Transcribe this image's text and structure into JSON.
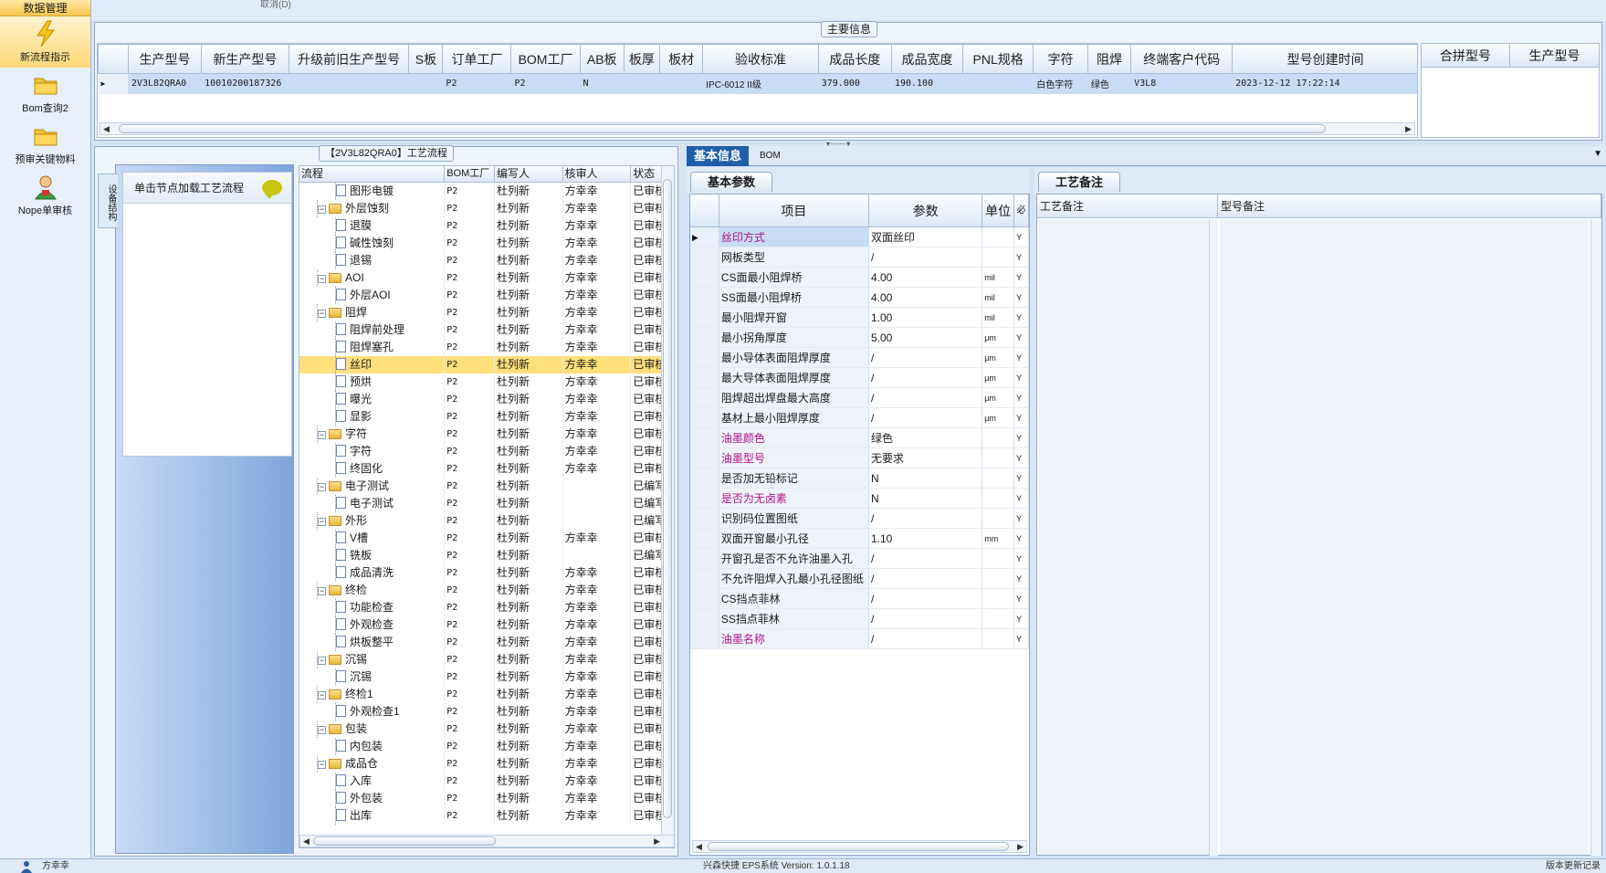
{
  "nav": {
    "header": "数据管理",
    "items": [
      {
        "label": "新流程指示",
        "icon": "lightning-icon"
      },
      {
        "label": "Bom查询2",
        "icon": "folder-icon"
      },
      {
        "label": "预审关键物料",
        "icon": "folder-icon"
      },
      {
        "label": "Nope单审核",
        "icon": "user-icon"
      }
    ]
  },
  "top_strip_text": "取消(D)",
  "main_info": {
    "legend": "主要信息",
    "columns": [
      "生产型号",
      "新生产型号",
      "升级前旧生产型号",
      "S板",
      "订单工厂",
      "BOM工厂",
      "AB板",
      "板厚",
      "板材",
      "验收标准",
      "成品长度",
      "成品宽度",
      "PNL规格",
      "字符",
      "阻焊",
      "终端客户代码",
      "型号创建时间"
    ],
    "row": [
      "2V3L82QRA0",
      "10010200187326",
      "",
      "",
      "P2",
      "P2",
      "N",
      "",
      "",
      "IPC-6012 II级",
      "379.000",
      "190.100",
      "",
      "白色字符",
      "绿色",
      "V3L8",
      "2023-12-12 17:22:14"
    ],
    "side_columns": [
      "合拼型号",
      "生产型号"
    ]
  },
  "process": {
    "legend": "【2V3L82QRA0】工艺流程",
    "side_tab": "设备结构",
    "hint": "单击节点加载工艺流程",
    "columns": [
      "流程",
      "BOM工厂",
      "编写人",
      "核审人",
      "状态"
    ],
    "rows": [
      {
        "name": "图形电镀",
        "level": 2,
        "folder": false,
        "bom": "P2",
        "editor": "杜列新",
        "reviewer": "方幸幸",
        "status": "已审核"
      },
      {
        "name": "外层蚀刻",
        "level": 1,
        "folder": true,
        "bom": "P2",
        "editor": "杜列新",
        "reviewer": "方幸幸",
        "status": "已审核"
      },
      {
        "name": "退膜",
        "level": 2,
        "folder": false,
        "bom": "P2",
        "editor": "杜列新",
        "reviewer": "方幸幸",
        "status": "已审核"
      },
      {
        "name": "碱性蚀刻",
        "level": 2,
        "folder": false,
        "bom": "P2",
        "editor": "杜列新",
        "reviewer": "方幸幸",
        "status": "已审核"
      },
      {
        "name": "退锡",
        "level": 2,
        "folder": false,
        "bom": "P2",
        "editor": "杜列新",
        "reviewer": "方幸幸",
        "status": "已审核"
      },
      {
        "name": "AOI",
        "level": 1,
        "folder": true,
        "bom": "P2",
        "editor": "杜列新",
        "reviewer": "方幸幸",
        "status": "已审核"
      },
      {
        "name": "外层AOI",
        "level": 2,
        "folder": false,
        "bom": "P2",
        "editor": "杜列新",
        "reviewer": "方幸幸",
        "status": "已审核"
      },
      {
        "name": "阻焊",
        "level": 1,
        "folder": true,
        "bom": "P2",
        "editor": "杜列新",
        "reviewer": "方幸幸",
        "status": "已审核"
      },
      {
        "name": "阻焊前处理",
        "level": 2,
        "folder": false,
        "bom": "P2",
        "editor": "杜列新",
        "reviewer": "方幸幸",
        "status": "已审核"
      },
      {
        "name": "阻焊塞孔",
        "level": 2,
        "folder": false,
        "bom": "P2",
        "editor": "杜列新",
        "reviewer": "方幸幸",
        "status": "已审核"
      },
      {
        "name": "丝印",
        "level": 2,
        "folder": false,
        "bom": "P2",
        "editor": "杜列新",
        "reviewer": "方幸幸",
        "status": "已审核",
        "selected": true
      },
      {
        "name": "预烘",
        "level": 2,
        "folder": false,
        "bom": "P2",
        "editor": "杜列新",
        "reviewer": "方幸幸",
        "status": "已审核"
      },
      {
        "name": "曝光",
        "level": 2,
        "folder": false,
        "bom": "P2",
        "editor": "杜列新",
        "reviewer": "方幸幸",
        "status": "已审核"
      },
      {
        "name": "显影",
        "level": 2,
        "folder": false,
        "bom": "P2",
        "editor": "杜列新",
        "reviewer": "方幸幸",
        "status": "已审核"
      },
      {
        "name": "字符",
        "level": 1,
        "folder": true,
        "bom": "P2",
        "editor": "杜列新",
        "reviewer": "方幸幸",
        "status": "已审核"
      },
      {
        "name": "字符",
        "level": 2,
        "folder": false,
        "bom": "P2",
        "editor": "杜列新",
        "reviewer": "方幸幸",
        "status": "已审核"
      },
      {
        "name": "终固化",
        "level": 2,
        "folder": false,
        "bom": "P2",
        "editor": "杜列新",
        "reviewer": "方幸幸",
        "status": "已审核"
      },
      {
        "name": "电子测试",
        "level": 1,
        "folder": true,
        "bom": "P2",
        "editor": "杜列新",
        "reviewer": "",
        "status": "已编写"
      },
      {
        "name": "电子测试",
        "level": 2,
        "folder": false,
        "bom": "P2",
        "editor": "杜列新",
        "reviewer": "",
        "status": "已编写"
      },
      {
        "name": "外形",
        "level": 1,
        "folder": true,
        "bom": "P2",
        "editor": "杜列新",
        "reviewer": "",
        "status": "已编写"
      },
      {
        "name": "V槽",
        "level": 2,
        "folder": false,
        "bom": "P2",
        "editor": "杜列新",
        "reviewer": "方幸幸",
        "status": "已审核"
      },
      {
        "name": "铣板",
        "level": 2,
        "folder": false,
        "bom": "P2",
        "editor": "杜列新",
        "reviewer": "",
        "status": "已编写"
      },
      {
        "name": "成品清洗",
        "level": 2,
        "folder": false,
        "bom": "P2",
        "editor": "杜列新",
        "reviewer": "方幸幸",
        "status": "已审核"
      },
      {
        "name": "终检",
        "level": 1,
        "folder": true,
        "bom": "P2",
        "editor": "杜列新",
        "reviewer": "方幸幸",
        "status": "已审核"
      },
      {
        "name": "功能检查",
        "level": 2,
        "folder": false,
        "bom": "P2",
        "editor": "杜列新",
        "reviewer": "方幸幸",
        "status": "已审核"
      },
      {
        "name": "外观检查",
        "level": 2,
        "folder": false,
        "bom": "P2",
        "editor": "杜列新",
        "reviewer": "方幸幸",
        "status": "已审核"
      },
      {
        "name": "烘板整平",
        "level": 2,
        "folder": false,
        "bom": "P2",
        "editor": "杜列新",
        "reviewer": "方幸幸",
        "status": "已审核"
      },
      {
        "name": "沉锡",
        "level": 1,
        "folder": true,
        "bom": "P2",
        "editor": "杜列新",
        "reviewer": "方幸幸",
        "status": "已审核"
      },
      {
        "name": "沉锡",
        "level": 2,
        "folder": false,
        "bom": "P2",
        "editor": "杜列新",
        "reviewer": "方幸幸",
        "status": "已审核"
      },
      {
        "name": "终检1",
        "level": 1,
        "folder": true,
        "bom": "P2",
        "editor": "杜列新",
        "reviewer": "方幸幸",
        "status": "已审核"
      },
      {
        "name": "外观检查1",
        "level": 2,
        "folder": false,
        "bom": "P2",
        "editor": "杜列新",
        "reviewer": "方幸幸",
        "status": "已审核"
      },
      {
        "name": "包装",
        "level": 1,
        "folder": true,
        "bom": "P2",
        "editor": "杜列新",
        "reviewer": "方幸幸",
        "status": "已审核"
      },
      {
        "name": "内包装",
        "level": 2,
        "folder": false,
        "bom": "P2",
        "editor": "杜列新",
        "reviewer": "方幸幸",
        "status": "已审核"
      },
      {
        "name": "成品仓",
        "level": 1,
        "folder": true,
        "bom": "P2",
        "editor": "杜列新",
        "reviewer": "方幸幸",
        "status": "已审核"
      },
      {
        "name": "入库",
        "level": 2,
        "folder": false,
        "bom": "P2",
        "editor": "杜列新",
        "reviewer": "方幸幸",
        "status": "已审核"
      },
      {
        "name": "外包装",
        "level": 2,
        "folder": false,
        "bom": "P2",
        "editor": "杜列新",
        "reviewer": "方幸幸",
        "status": "已审核"
      },
      {
        "name": "出库",
        "level": 2,
        "folder": false,
        "bom": "P2",
        "editor": "杜列新",
        "reviewer": "方幸幸",
        "status": "已审核"
      }
    ]
  },
  "right": {
    "tabs": [
      "基本信息",
      "BOM"
    ],
    "subtab_params": "基本参数",
    "subtab_remarks": "工艺备注",
    "param_columns": [
      "项目",
      "参数",
      "单位",
      "必"
    ],
    "params": [
      {
        "item": "丝印方式",
        "value": "双面丝印",
        "unit": "",
        "flag": "Y",
        "highlight": true,
        "selected": true
      },
      {
        "item": "网板类型",
        "value": "/",
        "unit": "",
        "flag": "Y"
      },
      {
        "item": "CS面最小阻焊桥",
        "value": "4.00",
        "unit": "mil",
        "flag": "Y"
      },
      {
        "item": "SS面最小阻焊桥",
        "value": "4.00",
        "unit": "mil",
        "flag": "Y"
      },
      {
        "item": "最小阻焊开窗",
        "value": "1.00",
        "unit": "mil",
        "flag": "Y"
      },
      {
        "item": "最小拐角厚度",
        "value": "5.00",
        "unit": "μm",
        "flag": "Y"
      },
      {
        "item": "最小导体表面阻焊厚度",
        "value": "/",
        "unit": "μm",
        "flag": "Y"
      },
      {
        "item": "最大导体表面阻焊厚度",
        "value": "/",
        "unit": "μm",
        "flag": "Y"
      },
      {
        "item": "阻焊超出焊盘最大高度",
        "value": "/",
        "unit": "μm",
        "flag": "Y"
      },
      {
        "item": "基材上最小阻焊厚度",
        "value": "/",
        "unit": "μm",
        "flag": "Y"
      },
      {
        "item": "油墨颜色",
        "value": "绿色",
        "unit": "",
        "flag": "Y",
        "highlight": true
      },
      {
        "item": "油墨型号",
        "value": "无要求",
        "unit": "",
        "flag": "Y",
        "highlight": true
      },
      {
        "item": "是否加无铅标记",
        "value": "N",
        "unit": "",
        "flag": "Y"
      },
      {
        "item": "是否为无卤素",
        "value": "N",
        "unit": "",
        "flag": "Y",
        "highlight": true
      },
      {
        "item": "识别码位置图纸",
        "value": "/",
        "unit": "",
        "flag": "Y"
      },
      {
        "item": "双面开窗最小孔径",
        "value": "1.10",
        "unit": "mm",
        "flag": "Y"
      },
      {
        "item": "开窗孔是否不允许油墨入孔",
        "value": "/",
        "unit": "",
        "flag": "Y"
      },
      {
        "item": "不允许阻焊入孔最小孔径图纸",
        "value": "/",
        "unit": "",
        "flag": "Y"
      },
      {
        "item": "CS挡点菲林",
        "value": "/",
        "unit": "",
        "flag": "Y"
      },
      {
        "item": "SS挡点菲林",
        "value": "/",
        "unit": "",
        "flag": "Y"
      },
      {
        "item": "油墨名称",
        "value": "/",
        "unit": "",
        "flag": "Y",
        "highlight": true
      }
    ],
    "remark_columns": [
      "工艺备注",
      "型号备注"
    ]
  },
  "status": {
    "left_icon": "user-icon",
    "user": "方幸幸",
    "center": "兴森快捷 EPS系统 Version: 1.0.1.18",
    "right": "版本更新记录"
  },
  "colors": {
    "accent": "#1f5fa8",
    "selected_row": "#ffe07a",
    "highlight_text": "#b3128a"
  }
}
